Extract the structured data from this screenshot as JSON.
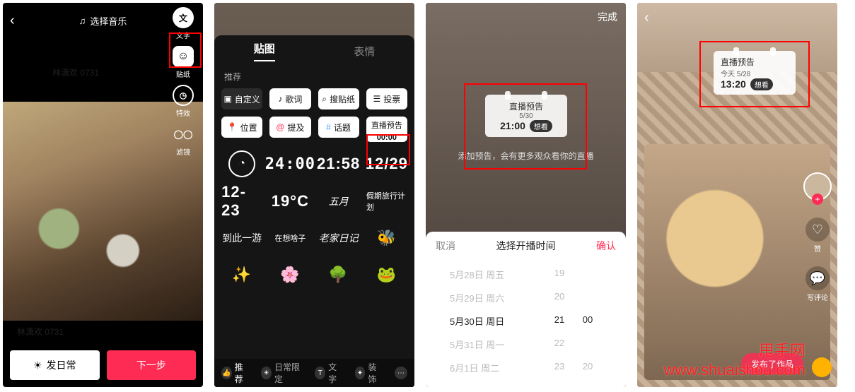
{
  "screen1": {
    "music_label": "选择音乐",
    "tools": {
      "text": "文字",
      "sticker": "贴纸",
      "fx": "特效",
      "filter": "滤镜"
    },
    "publish_daily": "发日常",
    "next": "下一步",
    "wm": "林潇欢 0731"
  },
  "screen2": {
    "tabs": {
      "sticker": "贴图",
      "emoji": "表情"
    },
    "recommend": "推荐",
    "chips": {
      "custom": "自定义",
      "lyrics": "歌词",
      "search_sticker": "搜贴纸",
      "vote": "投票",
      "location": "位置",
      "mention": "提及",
      "topic": "话题",
      "live_preview_label": "直播预告",
      "live_preview_time": "00:00"
    },
    "stickers": {
      "r1c1_icon": "◔",
      "r1c2": "24:00",
      "r1c3": "21:58",
      "r1c4": "12/29",
      "r2c1": "12-23",
      "r2c2": "19°C",
      "r2c3": "五月",
      "r2c4": "假期旅行计划",
      "r3c1": "到此一游",
      "r3c2": "在想啥子",
      "r3c3": "老家日记",
      "r3c4": "🐝",
      "r4c1": "✨",
      "r4c2": "🌸",
      "r4c3": "🌳",
      "r4c4": "🐸"
    },
    "bottombar": {
      "recommend": "推荐",
      "daily_limited": "日常限定",
      "text": "文字",
      "decor": "装饰"
    }
  },
  "screen3": {
    "done": "完成",
    "card": {
      "title": "直播预告",
      "date": "5/30",
      "time": "21:00",
      "want": "想看"
    },
    "hint": "添加预告，会有更多观众看你的直播",
    "sheet": {
      "cancel": "取消",
      "title": "选择开播时间",
      "confirm": "确认",
      "rows": [
        {
          "d": "5月28日 周五",
          "h": "19",
          "m": ""
        },
        {
          "d": "5月29日 周六",
          "h": "20",
          "m": ""
        },
        {
          "d": "5月30日 周日",
          "h": "21",
          "m": "00",
          "selected": true
        },
        {
          "d": "5月31日 周一",
          "h": "22",
          "m": ""
        },
        {
          "d": "6月1日 周二",
          "h": "23",
          "m": "20"
        }
      ]
    }
  },
  "screen4": {
    "card": {
      "title": "直播预告",
      "date": "今天 5/28",
      "time": "13:20",
      "want": "想看"
    },
    "side": {
      "like": "赞",
      "comment": "写评论"
    },
    "publish": "发布了作品"
  },
  "watermark": {
    "line1": "甩手网",
    "line2": "www.shuaishou.com"
  }
}
